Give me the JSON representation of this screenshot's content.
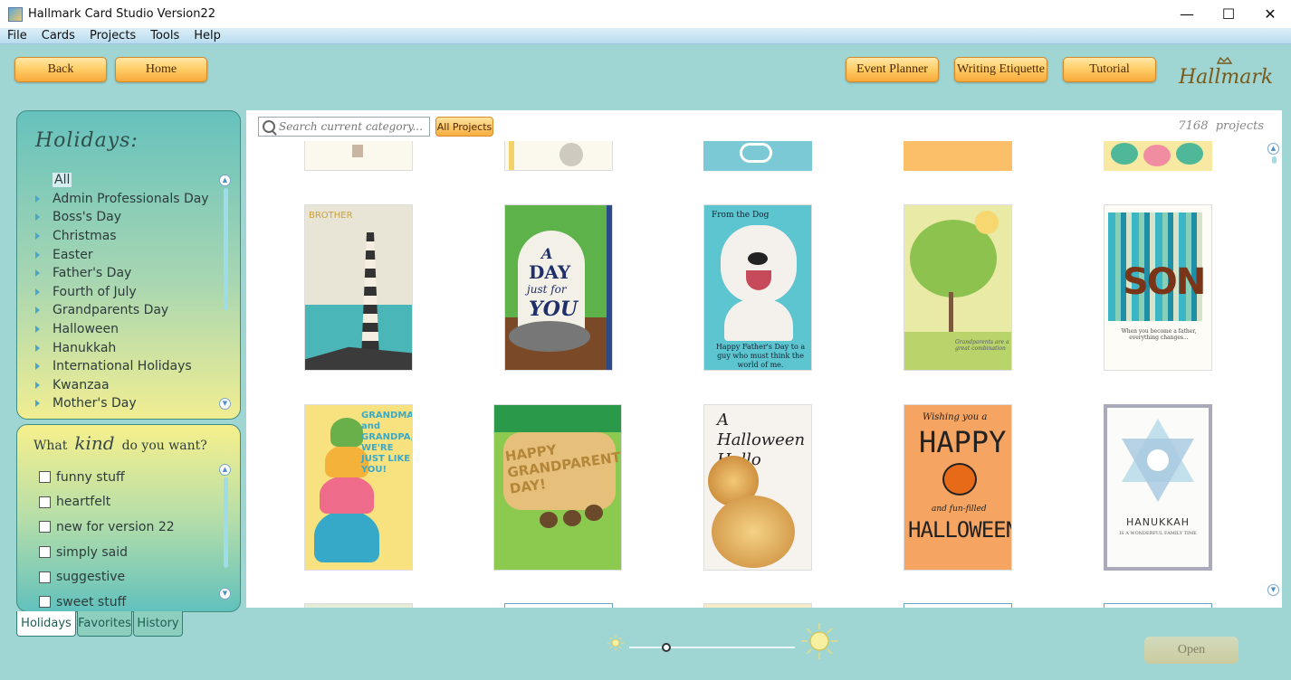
{
  "window": {
    "title": "Hallmark Card Studio Version22"
  },
  "menu": [
    "File",
    "Cards",
    "Projects",
    "Tools",
    "Help"
  ],
  "nav": {
    "back": "Back",
    "home": "Home",
    "event_planner": "Event Planner",
    "writing_etiquette": "Writing Etiquette",
    "tutorial": "Tutorial"
  },
  "logo": "Hallmark",
  "holidays": {
    "title": "Holidays:",
    "items": [
      "All",
      "Admin Professionals Day",
      "Boss's Day",
      "Christmas",
      "Easter",
      "Father's Day",
      "Fourth of July",
      "Grandparents Day",
      "Halloween",
      "Hanukkah",
      "International Holidays",
      "Kwanzaa",
      "Mother's Day"
    ],
    "selected": "All"
  },
  "kind": {
    "prefix": "What",
    "word": "kind",
    "suffix": "do you want?",
    "options": [
      "funny stuff",
      "heartfelt",
      "new for version 22",
      "simply said",
      "suggestive",
      "sweet stuff"
    ]
  },
  "tabs": [
    "Holidays",
    "Favorites",
    "History"
  ],
  "search": {
    "placeholder": "Search current category...",
    "all_projects": "All Projects"
  },
  "count": "7168",
  "count_label": "projects",
  "cards": {
    "brother": {
      "header": "BROTHER"
    },
    "cat": {
      "line1": "A",
      "line2": "DAY",
      "line3": "just for",
      "line4": "YOU"
    },
    "dog": {
      "top": "From the Dog",
      "bottom": "Happy Father's Day to a guy who must think the world of me."
    },
    "tree": {
      "text": "Grandparents are a great combination"
    },
    "son": {
      "word": "SON",
      "sub": "When you become a father, everything changes..."
    },
    "turtles": {
      "text": "GRANDMA and GRANDPA, WE'RE JUST LIKE YOU!"
    },
    "gpday": {
      "text": "HAPPY GRANDPARENTS DAY!"
    },
    "pumpkin": {
      "text": "A Halloween Hello"
    },
    "halloween": {
      "top": "Wishing you a",
      "happy": "HAPPY",
      "mid": "and fun-filled",
      "bottom": "HALLOWEEN"
    },
    "hanukkah": {
      "title": "HANUKKAH",
      "sub": "IS A WONDERFUL FAMILY TIME"
    }
  },
  "open_button": "Open",
  "colors": {
    "bg": "#9fd6d3",
    "accent": "#f7a93a",
    "panel_top": "#66c2bd",
    "panel_bottom": "#f1ee92"
  }
}
